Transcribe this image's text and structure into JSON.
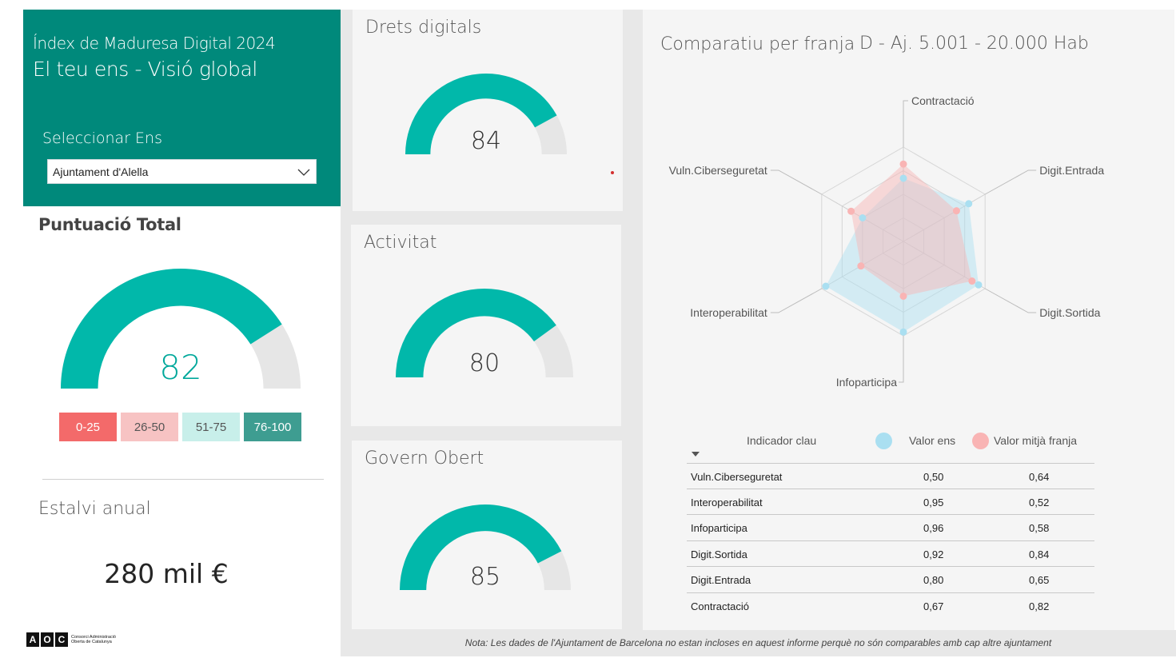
{
  "header": {
    "title": "Índex de Maduresa Digital 2024",
    "subtitle": "El teu ens - Visió global",
    "select_label": "Seleccionar Ens",
    "selected_ens": "Ajuntament d'Alella"
  },
  "total": {
    "title": "Puntuació Total",
    "score": "82",
    "score_value": 82,
    "legend": [
      "0-25",
      "26-50",
      "51-75",
      "76-100"
    ]
  },
  "savings": {
    "title": "Estalvi anual",
    "value": "280 mil €"
  },
  "logo": {
    "mark": [
      "A",
      "O",
      "C"
    ],
    "text": "Consorci Administració Oberta de Catalunya"
  },
  "cards": [
    {
      "title": "Drets digitals",
      "score": "84",
      "value": 84
    },
    {
      "title": "Activitat",
      "score": "80",
      "value": 80
    },
    {
      "title": "Govern Obert",
      "score": "85",
      "value": 85
    }
  ],
  "radar": {
    "title": "Comparatiu per franja",
    "band": "D - Aj. 5.001 - 20.000 Hab",
    "axes": [
      "Contractació",
      "Digit.Entrada",
      "Digit.Sortida",
      "Infoparticipa",
      "Interoperabilitat",
      "Vuln.Ciberseguretat"
    ]
  },
  "table": {
    "header_indicator": "Indicador clau",
    "header_ens": "Valor ens",
    "header_mitja": "Valor mitjà franja",
    "rows": [
      {
        "name": "Vuln.Ciberseguretat",
        "ens": "0,50",
        "mitja": "0,64"
      },
      {
        "name": "Interoperabilitat",
        "ens": "0,95",
        "mitja": "0,52"
      },
      {
        "name": "Infoparticipa",
        "ens": "0,96",
        "mitja": "0,58"
      },
      {
        "name": "Digit.Sortida",
        "ens": "0,92",
        "mitja": "0,84"
      },
      {
        "name": "Digit.Entrada",
        "ens": "0,80",
        "mitja": "0,65"
      },
      {
        "name": "Contractació",
        "ens": "0,67",
        "mitja": "0,82"
      }
    ]
  },
  "footer": {
    "note": "Nota: Les dades de l'Ajuntament de Barcelona no estan incloses en aquest informe perquè no són comparables amb cap altre ajuntament"
  },
  "colors": {
    "brand": "#00897b",
    "gauge_fill": "#01b8aa",
    "gauge_track": "#e6e6e6",
    "ens_series": "#aadff1",
    "mitja_series": "#f9b4b4"
  },
  "chart_data": {
    "type": "radar",
    "categories": [
      "Contractació",
      "Digit.Entrada",
      "Digit.Sortida",
      "Infoparticipa",
      "Interoperabilitat",
      "Vuln.Ciberseguretat"
    ],
    "series": [
      {
        "name": "Valor ens",
        "values": [
          0.67,
          0.8,
          0.92,
          0.96,
          0.95,
          0.5
        ]
      },
      {
        "name": "Valor mitjà franja",
        "values": [
          0.82,
          0.65,
          0.84,
          0.58,
          0.52,
          0.64
        ]
      }
    ],
    "rmax": 1.0
  }
}
